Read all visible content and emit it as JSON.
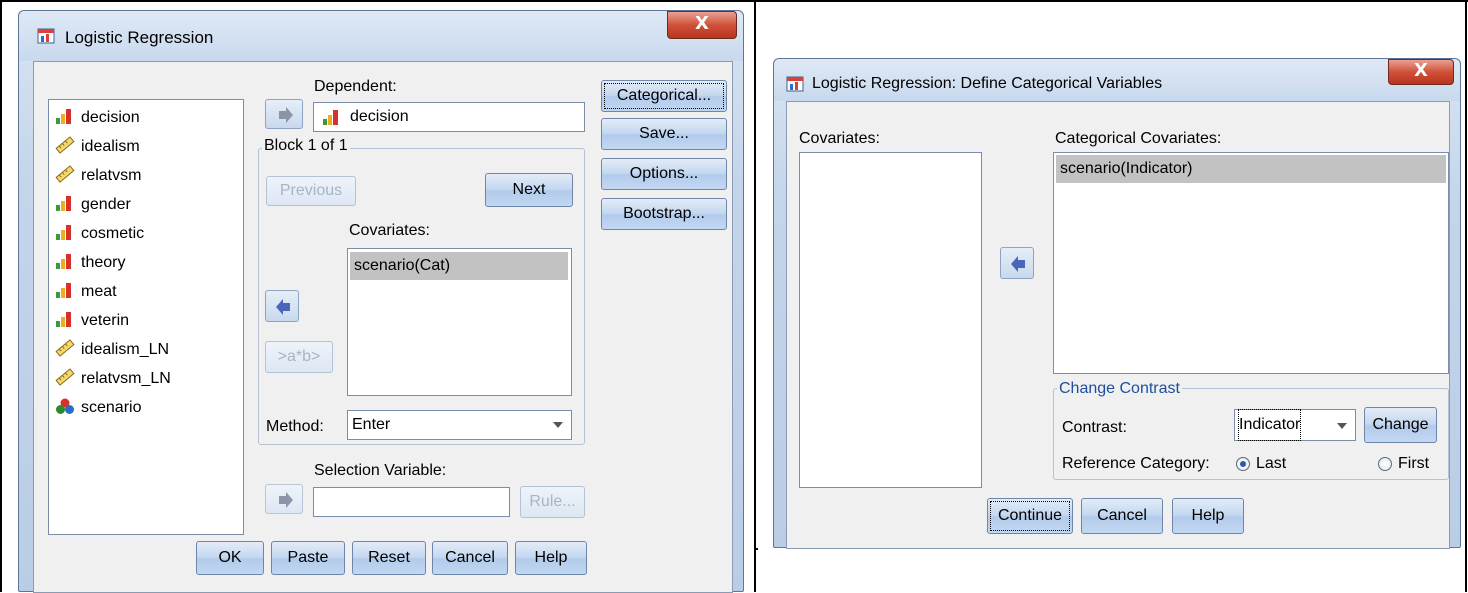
{
  "dialog1": {
    "title": "Logistic Regression",
    "close_label": "X",
    "variables": [
      {
        "label": "decision",
        "icon": "nominal-icon"
      },
      {
        "label": "idealism",
        "icon": "scale-icon"
      },
      {
        "label": "relatvsm",
        "icon": "scale-icon"
      },
      {
        "label": "gender",
        "icon": "nominal-icon"
      },
      {
        "label": "cosmetic",
        "icon": "nominal-icon"
      },
      {
        "label": "theory",
        "icon": "nominal-icon"
      },
      {
        "label": "meat",
        "icon": "nominal-icon"
      },
      {
        "label": "veterin",
        "icon": "nominal-icon"
      },
      {
        "label": "idealism_LN",
        "icon": "scale-icon"
      },
      {
        "label": "relatvsm_LN",
        "icon": "scale-icon"
      },
      {
        "label": "scenario",
        "icon": "categorical-icon"
      }
    ],
    "dependent_label": "Dependent:",
    "dependent_value": "decision",
    "block_label": "Block 1 of 1",
    "previous_label": "Previous",
    "next_label": "Next",
    "covariates_label": "Covariates:",
    "covariates_items": [
      "scenario(Cat)"
    ],
    "interaction_label": ">a*b>",
    "method_label": "Method:",
    "method_value": "Enter",
    "selection_label": "Selection Variable:",
    "selection_value": "",
    "rule_label": "Rule...",
    "side_buttons": [
      "Categorical...",
      "Save...",
      "Options...",
      "Bootstrap..."
    ],
    "bottom_buttons": [
      "OK",
      "Paste",
      "Reset",
      "Cancel",
      "Help"
    ]
  },
  "dialog2": {
    "title": "Logistic Regression: Define Categorical Variables",
    "close_label": "X",
    "covariates_label": "Covariates:",
    "categorical_label": "Categorical Covariates:",
    "categorical_items": [
      "scenario(Indicator)"
    ],
    "change_contrast_label": "Change Contrast",
    "contrast_label": "Contrast:",
    "contrast_value": "Indicator",
    "change_label": "Change",
    "reference_label": "Reference Category:",
    "last_label": "Last",
    "first_label": "First",
    "reference_selected": "Last",
    "bottom_buttons": [
      "Continue",
      "Cancel",
      "Help"
    ]
  }
}
